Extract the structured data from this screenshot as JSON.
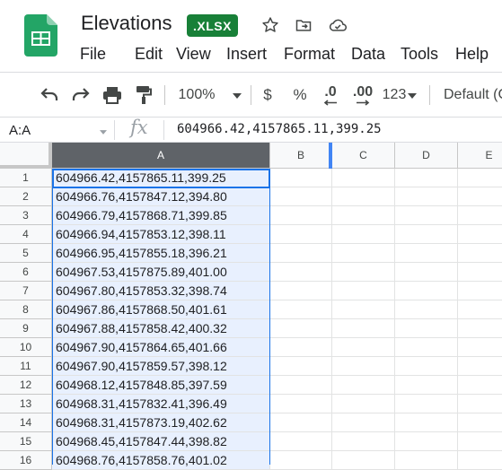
{
  "doc": {
    "title": "Elevations",
    "badge": ".XLSX"
  },
  "header_icons": [
    "star-icon",
    "move-folder-icon",
    "cloud-saved-icon"
  ],
  "menu": [
    "File",
    "Edit",
    "View",
    "Insert",
    "Format",
    "Data",
    "Tools",
    "Help"
  ],
  "toolbar": {
    "zoom": "100%",
    "currency": "$",
    "percent": "%",
    "decrease_decimal": ".0",
    "increase_decimal": ".00",
    "more_formats": "123",
    "font": "Default (C"
  },
  "formula_bar": {
    "name_box": "A:A",
    "fx": "fx",
    "content": "604966.42,4157865.11,399.25"
  },
  "grid": {
    "columns": [
      "A",
      "B",
      "C",
      "D",
      "E"
    ],
    "selected_column": "A",
    "rows": [
      {
        "n": "1",
        "a": "604966.42,4157865.11,399.25"
      },
      {
        "n": "2",
        "a": "604966.76,4157847.12,394.80"
      },
      {
        "n": "3",
        "a": "604966.79,4157868.71,399.85"
      },
      {
        "n": "4",
        "a": "604966.94,4157853.12,398.11"
      },
      {
        "n": "5",
        "a": "604966.95,4157855.18,396.21"
      },
      {
        "n": "6",
        "a": "604967.53,4157875.89,401.00"
      },
      {
        "n": "7",
        "a": "604967.80,4157853.32,398.74"
      },
      {
        "n": "8",
        "a": "604967.86,4157868.50,401.61"
      },
      {
        "n": "9",
        "a": "604967.88,4157858.42,400.32"
      },
      {
        "n": "10",
        "a": "604967.90,4157864.65,401.66"
      },
      {
        "n": "11",
        "a": "604967.90,4157859.57,398.12"
      },
      {
        "n": "12",
        "a": "604968.12,4157848.85,397.59"
      },
      {
        "n": "13",
        "a": "604968.31,4157832.41,396.49"
      },
      {
        "n": "14",
        "a": "604968.31,4157873.19,402.62"
      },
      {
        "n": "15",
        "a": "604968.45,4157847.44,398.82"
      },
      {
        "n": "16",
        "a": "604968.76,4157858.76,401.02"
      }
    ]
  },
  "colors": {
    "brand_green": "#188038",
    "sheets_green": "#23a566",
    "selection_blue": "#1a73e8",
    "selection_fill": "#e8f0fe",
    "selected_header": "#5f6368"
  }
}
